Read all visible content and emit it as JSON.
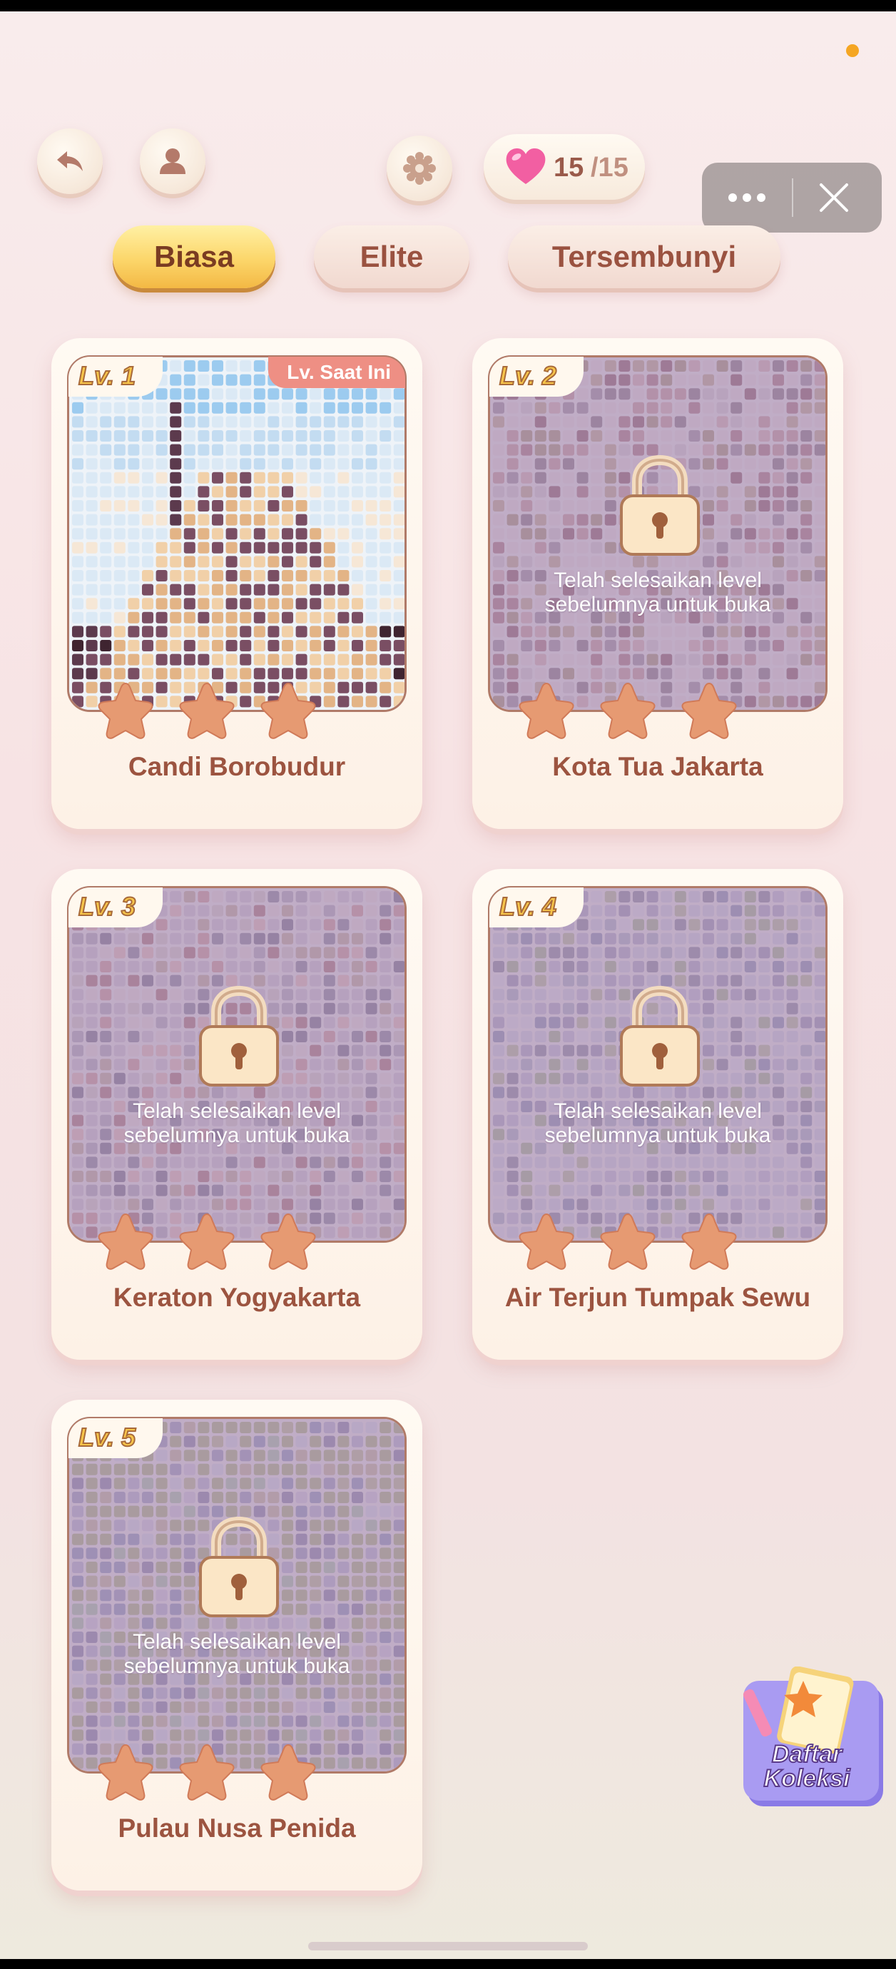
{
  "header": {
    "lives_current": "15",
    "lives_total": "/15"
  },
  "tabs": [
    {
      "label": "Biasa",
      "active": true
    },
    {
      "label": "Elite",
      "active": false
    },
    {
      "label": "Tersembunyi",
      "active": false
    }
  ],
  "current_tag": "Lv. Saat Ini",
  "lock_message": "Telah selesaikan level\nsebelumnya untuk buka",
  "levels": [
    {
      "badge": "Lv. 1",
      "title": "Candi Borobudur",
      "locked": false
    },
    {
      "badge": "Lv. 2",
      "title": "Kota Tua Jakarta",
      "locked": true
    },
    {
      "badge": "Lv. 3",
      "title": "Keraton Yogyakarta",
      "locked": true
    },
    {
      "badge": "Lv. 4",
      "title": "Air Terjun Tumpak Sewu",
      "locked": true
    },
    {
      "badge": "Lv. 5",
      "title": "Pulau Nusa Penida",
      "locked": true
    }
  ],
  "collection_button": {
    "line1": "Daftar",
    "line2": "Koleksi"
  },
  "colors": {
    "accent_yellow": "#fcd66a",
    "title_brown": "#9c5440",
    "star": "#e69a72",
    "current_tag": "#ee8f84"
  }
}
